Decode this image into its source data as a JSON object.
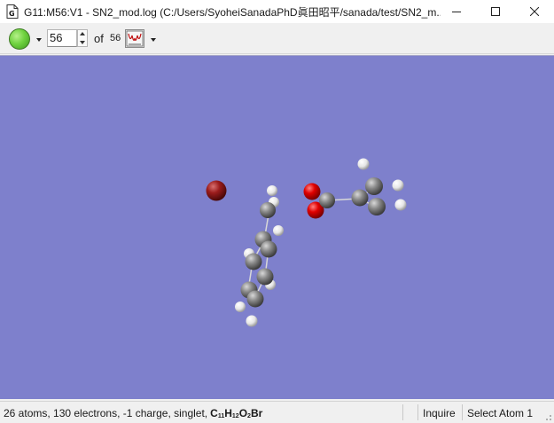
{
  "window": {
    "title": "G11:M56:V1 - SN2_mod.log (C:/Users/SyoheiSanadaPhD眞田昭平/sanada/test/SN2_m..."
  },
  "toolbar": {
    "frame_value": "56",
    "of_label": "of",
    "total_frames": "56"
  },
  "status": {
    "summary": "26 atoms, 130 electrons, -1 charge, singlet,",
    "formula_parts": {
      "c": "C",
      "c_n": "11",
      "h": "H",
      "h_n": "12",
      "o": "O",
      "o_n": "2",
      "br": "Br"
    },
    "mode": "Inquire",
    "action": "Select Atom 1"
  },
  "colors": {
    "viewport_background": "#7e80cc",
    "bromine": "#8b1a1a",
    "oxygen": "#e00000",
    "carbon": "#7a7a7a",
    "hydrogen": "#f2f2f2",
    "frame_ball": "#6fd23f"
  },
  "icons": {
    "app": "gaussview-document-icon",
    "minimize": "minimize-icon",
    "maximize": "maximize-icon",
    "close": "close-icon",
    "plot": "plot-graph-icon",
    "frame_ball": "animation-ball-icon"
  }
}
